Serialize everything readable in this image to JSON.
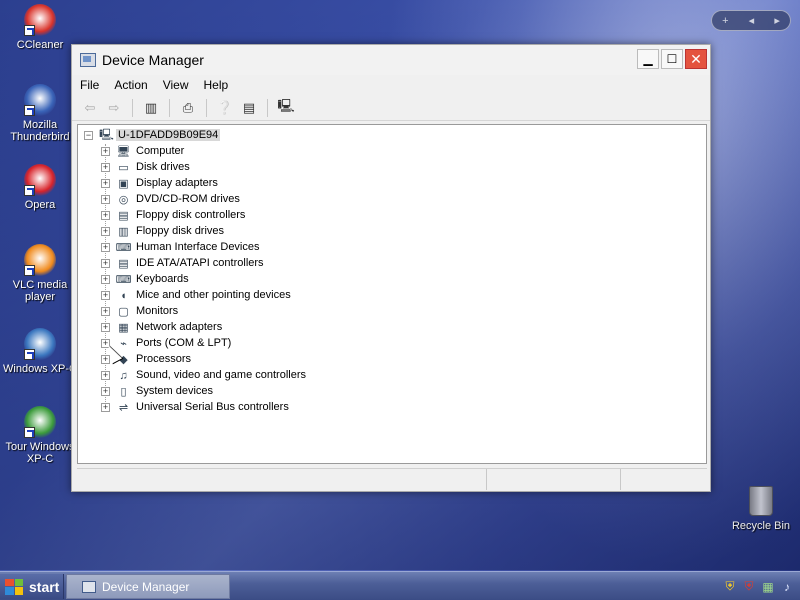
{
  "desktop": {
    "icons": [
      {
        "label": "CCleaner",
        "icon": "ccleaner-icon",
        "color": "#d9332a"
      },
      {
        "label": "Mozilla Thunderbird",
        "icon": "thunderbird-icon",
        "color": "#3a64b8"
      },
      {
        "label": "Opera",
        "icon": "opera-icon",
        "color": "#d8232a"
      },
      {
        "label": "VLC media player",
        "icon": "vlc-icon",
        "color": "#f08a1c"
      },
      {
        "label": "Windows XP-C",
        "icon": "windows-icon",
        "color": "#3c78c0"
      },
      {
        "label": "Tour Windows XP-C",
        "icon": "tour-icon",
        "color": "#3b9b3b"
      }
    ],
    "recycle_bin": "Recycle Bin",
    "gadget": {
      "add": "+",
      "prev": "◂",
      "next": "▸"
    }
  },
  "window": {
    "title": "Device Manager",
    "controls": {
      "minimize": "▁",
      "maximize": "☐",
      "close": "✕"
    },
    "menu": [
      "File",
      "Action",
      "View",
      "Help"
    ],
    "tree": {
      "root": "U-1DFADD9B09E94",
      "items": [
        {
          "label": "Computer",
          "icon": "computer-icon",
          "glyph": "🖥"
        },
        {
          "label": "Disk drives",
          "icon": "disk-drive-icon",
          "glyph": "▭"
        },
        {
          "label": "Display adapters",
          "icon": "display-adapter-icon",
          "glyph": "▣"
        },
        {
          "label": "DVD/CD-ROM drives",
          "icon": "dvd-icon",
          "glyph": "◎"
        },
        {
          "label": "Floppy disk controllers",
          "icon": "floppy-controller-icon",
          "glyph": "▤"
        },
        {
          "label": "Floppy disk drives",
          "icon": "floppy-drive-icon",
          "glyph": "▥"
        },
        {
          "label": "Human Interface Devices",
          "icon": "hid-icon",
          "glyph": "⌨"
        },
        {
          "label": "IDE ATA/ATAPI controllers",
          "icon": "ide-icon",
          "glyph": "▤"
        },
        {
          "label": "Keyboards",
          "icon": "keyboard-icon",
          "glyph": "⌨"
        },
        {
          "label": "Mice and other pointing devices",
          "icon": "mouse-icon",
          "glyph": "◖"
        },
        {
          "label": "Monitors",
          "icon": "monitor-icon",
          "glyph": "▢"
        },
        {
          "label": "Network adapters",
          "icon": "network-adapter-icon",
          "glyph": "▦"
        },
        {
          "label": "Ports (COM & LPT)",
          "icon": "port-icon",
          "glyph": "⌁"
        },
        {
          "label": "Processors",
          "icon": "processor-icon",
          "glyph": "◆"
        },
        {
          "label": "Sound, video and game controllers",
          "icon": "sound-icon",
          "glyph": "♫"
        },
        {
          "label": "System devices",
          "icon": "system-device-icon",
          "glyph": "▯"
        },
        {
          "label": "Universal Serial Bus controllers",
          "icon": "usb-icon",
          "glyph": "⇌"
        }
      ]
    }
  },
  "taskbar": {
    "start_label": "start",
    "task_label": "Device Manager"
  }
}
